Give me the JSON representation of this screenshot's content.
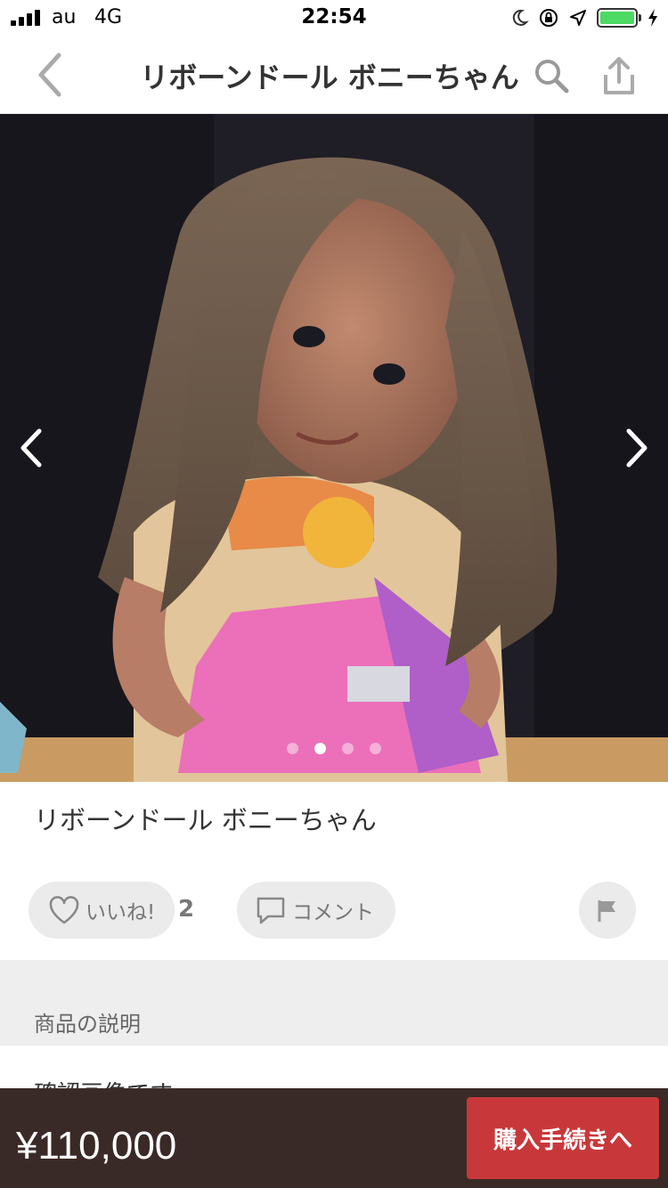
{
  "status_bar": {
    "carrier": "au",
    "network": "4G",
    "time": "22:54"
  },
  "nav": {
    "title": "リボーンドール ボニーちゃん",
    "icons": [
      "chevron-left-icon",
      "search-icon",
      "share-icon"
    ]
  },
  "carousel": {
    "image_count": 4,
    "active_index": 1
  },
  "product": {
    "title": "リボーンドール ボニーちゃん"
  },
  "actions": {
    "like_label": "いいね!",
    "like_count": "2",
    "comment_label": "コメント"
  },
  "description": {
    "header": "商品の説明",
    "text": "確認画像です"
  },
  "footer": {
    "price": "¥110,000",
    "buy_label": "購入手続きへ"
  },
  "colors": {
    "buy_button": "#c8383a",
    "bottom_bar": "#3a2a27",
    "battery": "#4cd964"
  }
}
